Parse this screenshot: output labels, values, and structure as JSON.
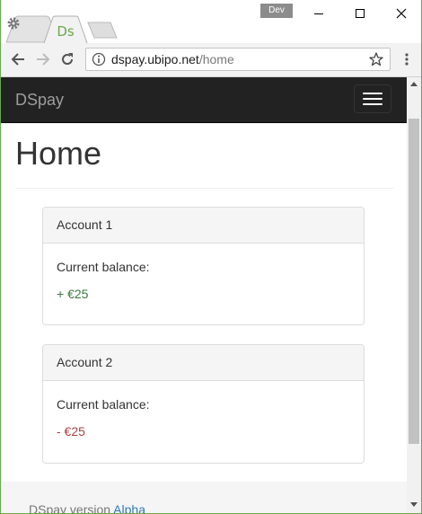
{
  "browser": {
    "tabs": [
      {
        "label": "",
        "icon": "gear-icon",
        "active": false
      },
      {
        "label": "Ds",
        "icon": "ds-favicon",
        "active": true
      },
      {
        "label": "",
        "icon": "new-tab",
        "active": false
      }
    ],
    "profile_badge": "Dev",
    "url_host": "dspay.ubipo.net",
    "url_path": "/home",
    "colors": {
      "frame_border": "#6aa84f",
      "favicon": "#6aa84f"
    }
  },
  "navbar": {
    "brand": "DSpay",
    "toggle_icon": "hamburger-menu-icon",
    "background": "#222222"
  },
  "page": {
    "title": "Home",
    "accounts": [
      {
        "name": "Account 1",
        "balance_label": "Current balance:",
        "balance": "+ €25",
        "color": "#3c763d"
      },
      {
        "name": "Account 2",
        "balance_label": "Current balance:",
        "balance": "- €25",
        "color": "#a94442"
      }
    ]
  },
  "footer": {
    "text": "DSpay version",
    "link": "Alpha"
  }
}
